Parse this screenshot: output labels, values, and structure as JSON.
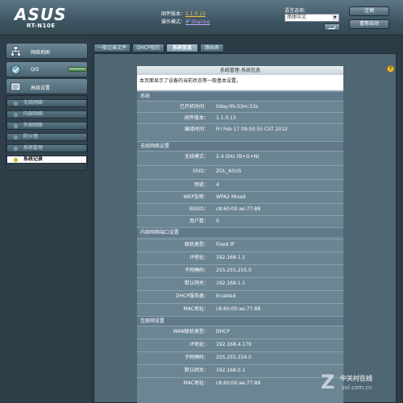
{
  "header": {
    "brand": "ASUS",
    "model": "RT-N10E",
    "firmware_label": "固件版本：",
    "firmware_value": "1.1.0.13",
    "mode_label": "操作模式：",
    "mode_value": "IP Sharing",
    "language_label": "语言选项：",
    "language_value": "简体中文",
    "logout_label": "注销",
    "reboot_label": "重新启动"
  },
  "sidebar": {
    "network_map": "网络地图",
    "qis": "QIS",
    "advanced": "高级设置",
    "sub_items": [
      {
        "label": "无线网络"
      },
      {
        "label": "内部网络"
      },
      {
        "label": "外部网络"
      },
      {
        "label": "防火墙"
      },
      {
        "label": "系统管理"
      },
      {
        "label": "系统记录"
      }
    ]
  },
  "tabs": [
    {
      "label": "一般记录文件"
    },
    {
      "label": "DHCP租约"
    },
    {
      "label": "系统信息"
    },
    {
      "label": "路由表"
    }
  ],
  "panel": {
    "title": "系统管理-系统信息",
    "description": "本页面显示了设备的当前状态等一般基本设置。",
    "sections": [
      {
        "title": "系统",
        "rows": [
          {
            "label": "已开机时间：",
            "value": "0day:0h:53m:53s"
          },
          {
            "label": "固件版本：",
            "value": "1.1.0.13"
          },
          {
            "label": "编译时间：",
            "value": "Fri Feb 17 09:50:55 CST 2012"
          }
        ]
      },
      {
        "title": "无线网络设置",
        "rows": [
          {
            "label": "无线模式：",
            "value": "2.4 GHz (B+G+N)"
          },
          {
            "label": "SSID：",
            "value": "ZOL_ASUS"
          },
          {
            "label": "频道：",
            "value": "4"
          },
          {
            "label": "WEP加密：",
            "value": "WPA2 Mixed"
          },
          {
            "label": "BSSID：",
            "value": "c8:60:00:ae:77:88"
          },
          {
            "label": "用户数：",
            "value": "0"
          }
        ]
      },
      {
        "title": "内部网络端口设置",
        "rows": [
          {
            "label": "联机类型：",
            "value": "Fixed IP"
          },
          {
            "label": "IP地址：",
            "value": "192.168.1.1"
          },
          {
            "label": "子网掩码：",
            "value": "255.255.255.0"
          },
          {
            "label": "默认网关：",
            "value": "192.168.1.1"
          },
          {
            "label": "DHCP服务器：",
            "value": "Enabled"
          },
          {
            "label": "MAC地址：",
            "value": "c8:60:00:ae:77:88"
          }
        ]
      },
      {
        "title": "互联网设置",
        "rows": [
          {
            "label": "WAN联机类型：",
            "value": "DHCP"
          },
          {
            "label": "IP地址：",
            "value": "192.168.4.179"
          },
          {
            "label": "子网掩码：",
            "value": "255.255.224.0"
          },
          {
            "label": "默认网关：",
            "value": "192.168.0.1"
          },
          {
            "label": "MAC地址：",
            "value": "c8:60:00:ae:77:88"
          }
        ]
      }
    ]
  },
  "watermark": {
    "letter": "Z",
    "cn": "中关村在线",
    "url": "zol.com.cn"
  }
}
